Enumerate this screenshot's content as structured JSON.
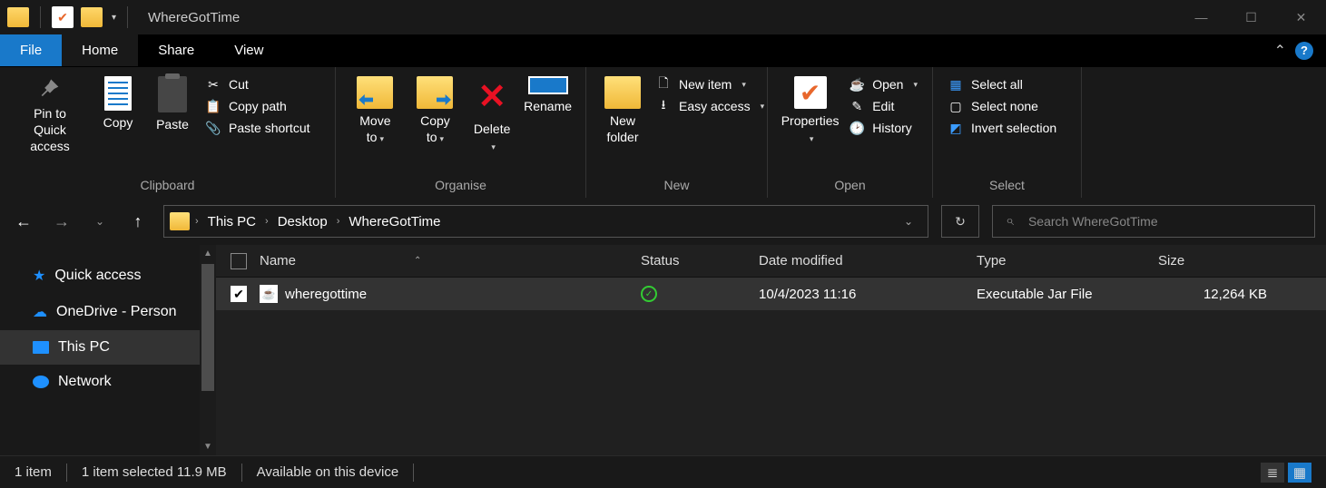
{
  "window": {
    "title": "WhereGotTime"
  },
  "tabs": {
    "file": "File",
    "home": "Home",
    "share": "Share",
    "view": "View"
  },
  "ribbon": {
    "clipboard": {
      "group": "Clipboard",
      "pin": "Pin to Quick access",
      "copy": "Copy",
      "paste": "Paste",
      "cut": "Cut",
      "copypath": "Copy path",
      "pasteshortcut": "Paste shortcut"
    },
    "organise": {
      "group": "Organise",
      "moveto": "Move to",
      "copyto": "Copy to",
      "delete": "Delete",
      "rename": "Rename"
    },
    "new": {
      "group": "New",
      "newfolder": "New folder",
      "newitem": "New item",
      "easyaccess": "Easy access"
    },
    "open": {
      "group": "Open",
      "properties": "Properties",
      "open": "Open",
      "edit": "Edit",
      "history": "History"
    },
    "select": {
      "group": "Select",
      "all": "Select all",
      "none": "Select none",
      "invert": "Invert selection"
    }
  },
  "breadcrumb": {
    "p0": "This PC",
    "p1": "Desktop",
    "p2": "WhereGotTime"
  },
  "search": {
    "placeholder": "Search WhereGotTime"
  },
  "sidebar": {
    "quick": "Quick access",
    "onedrive": "OneDrive - Person",
    "thispc": "This PC",
    "network": "Network"
  },
  "columns": {
    "name": "Name",
    "status": "Status",
    "date": "Date modified",
    "type": "Type",
    "size": "Size"
  },
  "files": [
    {
      "name": "wheregottime",
      "date": "10/4/2023 11:16",
      "type": "Executable Jar File",
      "size": "12,264 KB"
    }
  ],
  "status": {
    "count": "1 item",
    "selected": "1 item selected  11.9 MB",
    "avail": "Available on this device"
  }
}
